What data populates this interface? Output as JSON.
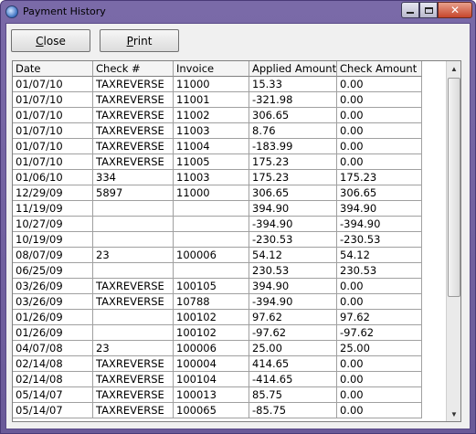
{
  "window": {
    "title": "Payment History",
    "icon": "app-globe-icon"
  },
  "toolbar": {
    "close_label_u": "C",
    "close_label_rest": "lose",
    "print_label_u": "P",
    "print_label_rest": "rint"
  },
  "table": {
    "columns": [
      "Date",
      "Check #",
      "Invoice",
      "Applied Amount",
      "Check Amount"
    ],
    "rows": [
      [
        "01/07/10",
        "TAXREVERSE",
        "11000",
        "15.33",
        "0.00"
      ],
      [
        "01/07/10",
        "TAXREVERSE",
        "11001",
        "-321.98",
        "0.00"
      ],
      [
        "01/07/10",
        "TAXREVERSE",
        "11002",
        "306.65",
        "0.00"
      ],
      [
        "01/07/10",
        "TAXREVERSE",
        "11003",
        "8.76",
        "0.00"
      ],
      [
        "01/07/10",
        "TAXREVERSE",
        "11004",
        "-183.99",
        "0.00"
      ],
      [
        "01/07/10",
        "TAXREVERSE",
        "11005",
        "175.23",
        "0.00"
      ],
      [
        "01/06/10",
        "334",
        "11003",
        "175.23",
        "175.23"
      ],
      [
        "12/29/09",
        "5897",
        "11000",
        "306.65",
        "306.65"
      ],
      [
        "11/19/09",
        "",
        "",
        "394.90",
        "394.90"
      ],
      [
        "10/27/09",
        "",
        "",
        "-394.90",
        "-394.90"
      ],
      [
        "10/19/09",
        "",
        "",
        "-230.53",
        "-230.53"
      ],
      [
        "08/07/09",
        "23",
        "100006",
        "54.12",
        "54.12"
      ],
      [
        "06/25/09",
        "",
        "",
        "230.53",
        "230.53"
      ],
      [
        "03/26/09",
        "TAXREVERSE",
        "100105",
        "394.90",
        "0.00"
      ],
      [
        "03/26/09",
        "TAXREVERSE",
        "10788",
        "-394.90",
        "0.00"
      ],
      [
        "01/26/09",
        "",
        "100102",
        "97.62",
        "97.62"
      ],
      [
        "01/26/09",
        "",
        "100102",
        "-97.62",
        "-97.62"
      ],
      [
        "04/07/08",
        "23",
        "100006",
        "25.00",
        "25.00"
      ],
      [
        "02/14/08",
        "TAXREVERSE",
        "100004",
        "414.65",
        "0.00"
      ],
      [
        "02/14/08",
        "TAXREVERSE",
        "100104",
        "-414.65",
        "0.00"
      ],
      [
        "05/14/07",
        "TAXREVERSE",
        "100013",
        "85.75",
        "0.00"
      ],
      [
        "05/14/07",
        "TAXREVERSE",
        "100065",
        "-85.75",
        "0.00"
      ]
    ]
  }
}
